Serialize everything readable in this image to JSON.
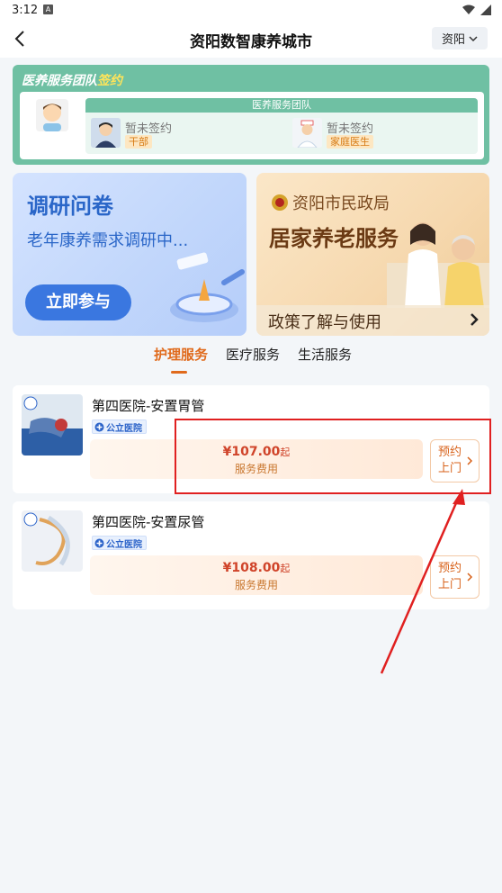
{
  "status_bar": {
    "time": "3:12",
    "indicator": "A"
  },
  "nav": {
    "title": "资阳数智康养城市",
    "city": "资阳"
  },
  "team_card": {
    "title_prefix": "医养服务团队",
    "title_suffix": "签约",
    "panel_title": "医养服务团队",
    "members": [
      {
        "status": "暂未签约",
        "role": "干部"
      },
      {
        "status": "暂未签约",
        "role": "家庭医生"
      }
    ]
  },
  "banner_left": {
    "title": "调研问卷",
    "subtitle": "老年康养需求调研中...",
    "button": "立即参与"
  },
  "banner_right": {
    "org": "资阳市民政局",
    "title": "居家养老服务",
    "footer": "政策了解与使用"
  },
  "tabs": [
    {
      "label": "护理服务",
      "active": true
    },
    {
      "label": "医疗服务",
      "active": false
    },
    {
      "label": "生活服务",
      "active": false
    }
  ],
  "services": [
    {
      "name": "第四医院-安置胃管",
      "tag": "公立医院",
      "price": "¥107.00",
      "price_suffix": "起",
      "fee_label": "服务费用",
      "book_line1": "预约",
      "book_line2": "上门"
    },
    {
      "name": "第四医院-安置尿管",
      "tag": "公立医院",
      "price": "¥108.00",
      "price_suffix": "起",
      "fee_label": "服务费用",
      "book_line1": "预约",
      "book_line2": "上门"
    }
  ],
  "colors": {
    "accent": "#e06a1c",
    "team_green": "#6fc0a3",
    "annotation_red": "#e02020"
  }
}
